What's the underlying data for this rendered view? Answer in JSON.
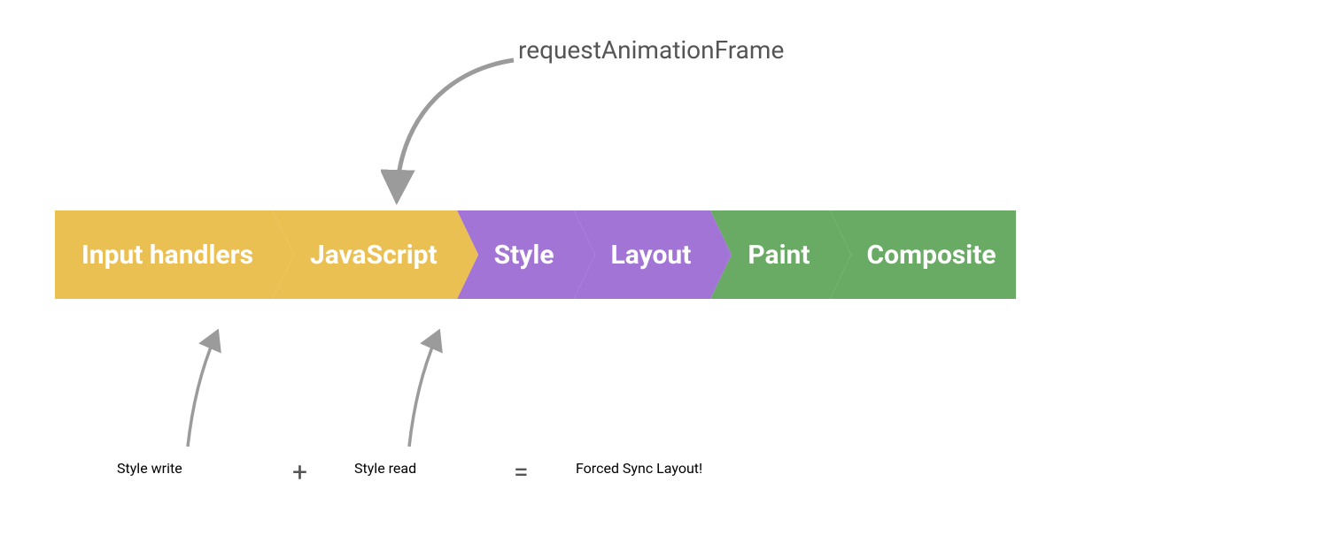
{
  "pipeline": {
    "steps": [
      {
        "label": "Input handlers",
        "color": "yellow"
      },
      {
        "label": "JavaScript",
        "color": "yellow"
      },
      {
        "label": "Style",
        "color": "purple"
      },
      {
        "label": "Layout",
        "color": "purple"
      },
      {
        "label": "Paint",
        "color": "green"
      },
      {
        "label": "Composite",
        "color": "green"
      }
    ]
  },
  "top_annotation": {
    "label": "requestAnimationFrame"
  },
  "bottom_annotation": {
    "left_label": "Style write",
    "plus": "+",
    "right_label": "Style read",
    "equals": "=",
    "result": "Forced Sync Layout!"
  }
}
